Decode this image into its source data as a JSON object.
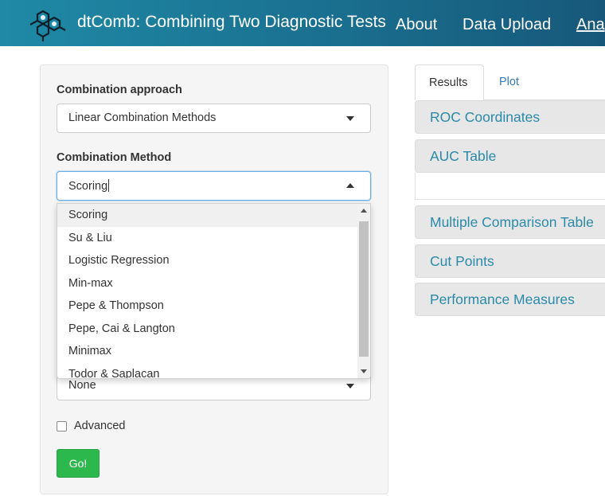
{
  "navbar": {
    "brand": "dtComb: Combining Two Diagnostic Tests",
    "links": [
      "About",
      "Data Upload",
      "Ana"
    ]
  },
  "sidebar": {
    "approach_label": "Combination approach",
    "approach_value": "Linear Combination Methods",
    "method_label": "Combination Method",
    "method_value": "Scoring",
    "method_options": [
      "Scoring",
      "Su & Liu",
      "Logistic Regression",
      "Min-max",
      "Pepe & Thompson",
      "Pepe, Cai & Langton",
      "Minimax",
      "Todor & Saplacan"
    ],
    "hidden_select_value": "None",
    "advanced_label": "Advanced",
    "go_label": "Go!"
  },
  "tabs": [
    "Results",
    "Plot"
  ],
  "panels": [
    "ROC Coordinates",
    "AUC Table",
    "Multiple Comparison Table",
    "Cut Points",
    "Performance Measures"
  ],
  "colors": {
    "navbar": "#1a6f8f",
    "accent_link": "#2a8aa8",
    "go_button": "#2db84d"
  }
}
